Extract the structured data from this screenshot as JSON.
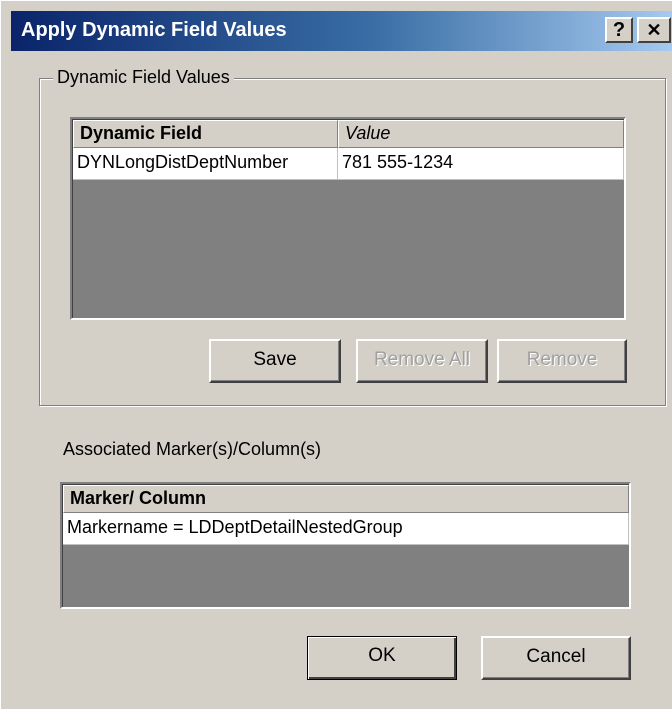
{
  "window": {
    "title": "Apply Dynamic Field Values",
    "help_button": "?",
    "close_button": "✕"
  },
  "dynamic_fields": {
    "group_caption": "Dynamic Field Values",
    "columns": [
      "Dynamic Field",
      "Value"
    ],
    "rows": [
      {
        "field": "DYNLongDistDeptNumber",
        "value": "781 555-1234"
      }
    ],
    "buttons": {
      "save": "Save",
      "remove_all": "Remove All",
      "remove": "Remove"
    }
  },
  "associated": {
    "label": "Associated Marker(s)/Column(s)",
    "columns": [
      "Marker/ Column"
    ],
    "rows": [
      {
        "marker": "Markername = LDDeptDetailNestedGroup"
      }
    ]
  },
  "footer": {
    "ok": "OK",
    "cancel": "Cancel"
  },
  "colors": {
    "face": "#d4d0c8",
    "title_start": "#0a246a",
    "title_end": "#a6caf0",
    "grid_empty": "#808080"
  }
}
